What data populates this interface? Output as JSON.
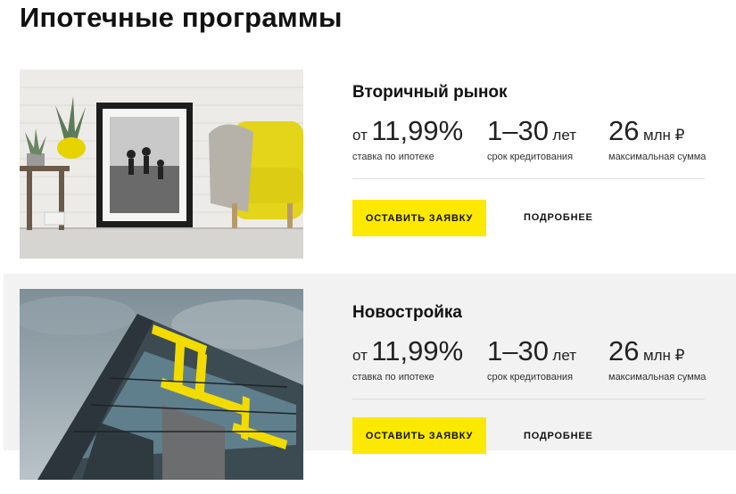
{
  "page": {
    "title": "Ипотечные программы"
  },
  "colors": {
    "accent": "#fde800",
    "band_bg": "#f1f2f1",
    "divider": "#dcdcdc",
    "text": "#111111"
  },
  "programs": [
    {
      "title": "Вторичный рынок",
      "rate": {
        "prefix": "от",
        "value": "11,99%",
        "caption": "ставка по ипотеке"
      },
      "term": {
        "value": "1–30",
        "unit": "лет",
        "caption": "срок кредитования"
      },
      "amount": {
        "value": "26",
        "unit": "млн ₽",
        "caption": "максимальная сумма"
      },
      "apply_label": "Оставить заявку",
      "more_label": "Подробнее",
      "image": "living-room-yellow-sofa-photo"
    },
    {
      "title": "Новостройка",
      "rate": {
        "prefix": "от",
        "value": "11,99%",
        "caption": "ставка по ипотеке"
      },
      "term": {
        "value": "1–30",
        "unit": "лет",
        "caption": "срок кредитования"
      },
      "amount": {
        "value": "26",
        "unit": "млн ₽",
        "caption": "максимальная сумма"
      },
      "apply_label": "Оставить заявку",
      "more_label": "Подробнее",
      "image": "modern-building-yellow-facade-photo"
    }
  ]
}
